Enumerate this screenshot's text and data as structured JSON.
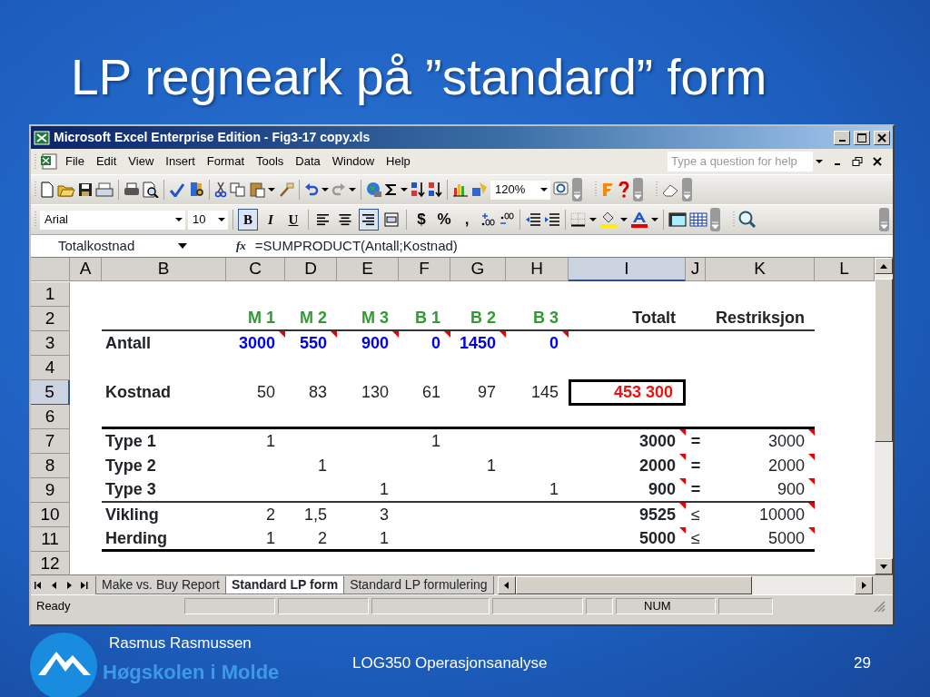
{
  "slide": {
    "title": "LP regneark på ”standard” form",
    "author": "Rasmus Rasmussen",
    "logo_text": "Høgskolen i Molde",
    "course": "LOG350 Operasjonsanalyse",
    "page_number": "29"
  },
  "window": {
    "title": "Microsoft Excel Enterprise Edition - Fig3-17 copy.xls"
  },
  "menu": [
    "File",
    "Edit",
    "View",
    "Insert",
    "Format",
    "Tools",
    "Data",
    "Window",
    "Help"
  ],
  "help": {
    "placeholder": "Type a question for help"
  },
  "zoom": "120%",
  "font": {
    "name": "Arial",
    "size": "10"
  },
  "style_buttons": [
    {
      "kind": "bold",
      "label": "B",
      "on": true
    },
    {
      "kind": "italic",
      "label": "I",
      "on": false
    },
    {
      "kind": "underline",
      "label": "U",
      "on": false
    }
  ],
  "align_buttons": [
    {
      "kind": "left",
      "on": false
    },
    {
      "kind": "center",
      "on": false
    },
    {
      "kind": "right",
      "on": true
    },
    {
      "kind": "merge",
      "on": false
    }
  ],
  "number_buttons": [
    "$",
    "%",
    ","
  ],
  "formula_bar": {
    "name_box": "Totalkostnad",
    "fx": "fx",
    "formula": "=SUMPRODUCT(Antall;Kostnad)"
  },
  "columns": [
    {
      "label": "A",
      "selected": false
    },
    {
      "label": "B",
      "selected": false
    },
    {
      "label": "C",
      "selected": false
    },
    {
      "label": "D",
      "selected": false
    },
    {
      "label": "E",
      "selected": false
    },
    {
      "label": "F",
      "selected": false
    },
    {
      "label": "G",
      "selected": false
    },
    {
      "label": "H",
      "selected": false
    },
    {
      "label": "I",
      "selected": true
    },
    {
      "label": "J",
      "selected": false
    },
    {
      "label": "K",
      "selected": false
    },
    {
      "label": "L",
      "selected": false
    }
  ],
  "rows": [
    {
      "label": "1",
      "selected": false,
      "rule_below": false
    },
    {
      "label": "2",
      "selected": false,
      "rule_below": true,
      "rule_heavy": false,
      "cells": [
        {},
        {},
        {
          "text": "M 1",
          "kind": "product",
          "comment": false,
          "selected": false
        },
        {
          "text": "M 2",
          "kind": "product",
          "comment": false,
          "selected": false
        },
        {
          "text": "M 3",
          "kind": "product",
          "comment": false,
          "selected": false
        },
        {
          "text": "B 1",
          "kind": "product",
          "comment": false,
          "selected": false
        },
        {
          "text": "B 2",
          "kind": "product",
          "comment": false,
          "selected": false
        },
        {
          "text": "B 3",
          "kind": "product",
          "comment": false,
          "selected": false
        },
        {
          "text": "Totalt",
          "kind": "heading",
          "comment": false,
          "selected": false
        },
        {},
        {
          "text": "Restriksjon",
          "kind": "heading",
          "comment": false,
          "selected": false
        }
      ]
    },
    {
      "label": "3",
      "selected": false,
      "rule_below": false,
      "cells": [
        {},
        {
          "text": "Antall",
          "kind": "label",
          "comment": false,
          "selected": false
        },
        {
          "text": "3000",
          "kind": "input",
          "comment": true,
          "selected": false
        },
        {
          "text": "550",
          "kind": "input",
          "comment": true,
          "selected": false
        },
        {
          "text": "900",
          "kind": "input",
          "comment": true,
          "selected": false
        },
        {
          "text": "0",
          "kind": "input",
          "comment": true,
          "selected": false
        },
        {
          "text": "1450",
          "kind": "input",
          "comment": true,
          "selected": false
        },
        {
          "text": "0",
          "kind": "input",
          "comment": true,
          "selected": false
        }
      ]
    },
    {
      "label": "4",
      "selected": false,
      "rule_below": false
    },
    {
      "label": "5",
      "selected": true,
      "rule_below": false,
      "cells": [
        {},
        {
          "text": "Kostnad",
          "kind": "label",
          "comment": false,
          "selected": false
        },
        {
          "text": "50",
          "kind": "number",
          "comment": false,
          "selected": false
        },
        {
          "text": "83",
          "kind": "number",
          "comment": false,
          "selected": false
        },
        {
          "text": "130",
          "kind": "number",
          "comment": false,
          "selected": false
        },
        {
          "text": "61",
          "kind": "number",
          "comment": false,
          "selected": false
        },
        {
          "text": "97",
          "kind": "number",
          "comment": false,
          "selected": false
        },
        {
          "text": "145",
          "kind": "number",
          "comment": false,
          "selected": false
        },
        {
          "text": "453 300",
          "kind": "objective",
          "comment": false,
          "selected": true
        }
      ]
    },
    {
      "label": "6",
      "selected": false,
      "rule_below": true,
      "rule_heavy": true
    },
    {
      "label": "7",
      "selected": false,
      "rule_below": false,
      "cells": [
        {},
        {
          "text": "Type 1",
          "kind": "label",
          "comment": false,
          "selected": false
        },
        {
          "text": "1",
          "kind": "number",
          "comment": false,
          "selected": false
        },
        {},
        {},
        {
          "text": "1",
          "kind": "number",
          "comment": false,
          "selected": false
        },
        {},
        {},
        {
          "text": "3000",
          "kind": "total",
          "comment": true,
          "selected": false
        },
        {
          "text": "=",
          "kind": "sign",
          "comment": false,
          "selected": false
        },
        {
          "text": "3000",
          "kind": "limit",
          "comment": true,
          "selected": false
        }
      ]
    },
    {
      "label": "8",
      "selected": false,
      "rule_below": false,
      "cells": [
        {},
        {
          "text": "Type 2",
          "kind": "label",
          "comment": false,
          "selected": false
        },
        {},
        {
          "text": "1",
          "kind": "number",
          "comment": false,
          "selected": false
        },
        {},
        {},
        {
          "text": "1",
          "kind": "number",
          "comment": false,
          "selected": false
        },
        {},
        {
          "text": "2000",
          "kind": "total",
          "comment": true,
          "selected": false
        },
        {
          "text": "=",
          "kind": "sign",
          "comment": false,
          "selected": false
        },
        {
          "text": "2000",
          "kind": "limit",
          "comment": true,
          "selected": false
        }
      ]
    },
    {
      "label": "9",
      "selected": false,
      "rule_below": true,
      "rule_heavy": false,
      "cells": [
        {},
        {
          "text": "Type 3",
          "kind": "label",
          "comment": false,
          "selected": false
        },
        {},
        {},
        {
          "text": "1",
          "kind": "number",
          "comment": false,
          "selected": false
        },
        {},
        {},
        {
          "text": "1",
          "kind": "number",
          "comment": false,
          "selected": false
        },
        {
          "text": "900",
          "kind": "total",
          "comment": true,
          "selected": false
        },
        {
          "text": "=",
          "kind": "sign",
          "comment": false,
          "selected": false
        },
        {
          "text": "900",
          "kind": "limit",
          "comment": true,
          "selected": false
        }
      ]
    },
    {
      "label": "10",
      "selected": false,
      "rule_below": false,
      "cells": [
        {},
        {
          "text": "Vikling",
          "kind": "label",
          "comment": false,
          "selected": false
        },
        {
          "text": "2",
          "kind": "number",
          "comment": false,
          "selected": false
        },
        {
          "text": "1,5",
          "kind": "number",
          "comment": false,
          "selected": false
        },
        {
          "text": "3",
          "kind": "number",
          "comment": false,
          "selected": false
        },
        {},
        {},
        {},
        {
          "text": "9525",
          "kind": "total",
          "comment": true,
          "selected": false
        },
        {
          "text": "≤",
          "kind": "relation",
          "comment": false,
          "selected": false
        },
        {
          "text": "10000",
          "kind": "limit",
          "comment": true,
          "selected": false
        }
      ]
    },
    {
      "label": "11",
      "selected": false,
      "rule_below": true,
      "rule_heavy": true,
      "cells": [
        {},
        {
          "text": "Herding",
          "kind": "label",
          "comment": false,
          "selected": false
        },
        {
          "text": "1",
          "kind": "number",
          "comment": false,
          "selected": false
        },
        {
          "text": "2",
          "kind": "number",
          "comment": false,
          "selected": false
        },
        {
          "text": "1",
          "kind": "number",
          "comment": false,
          "selected": false
        },
        {},
        {},
        {},
        {
          "text": "5000",
          "kind": "total",
          "comment": true,
          "selected": false
        },
        {
          "text": "≤",
          "kind": "relation",
          "comment": false,
          "selected": false
        },
        {
          "text": "5000",
          "kind": "limit",
          "comment": true,
          "selected": false
        }
      ]
    },
    {
      "label": "12",
      "selected": false,
      "rule_below": false
    }
  ],
  "sheet_tabs": [
    {
      "label": "Make vs. Buy Report",
      "selected": false
    },
    {
      "label": "Standard LP form",
      "selected": true
    },
    {
      "label": "Standard LP formulering",
      "selected": false
    }
  ],
  "status_bar": {
    "message": "Ready",
    "indicator": "NUM"
  }
}
